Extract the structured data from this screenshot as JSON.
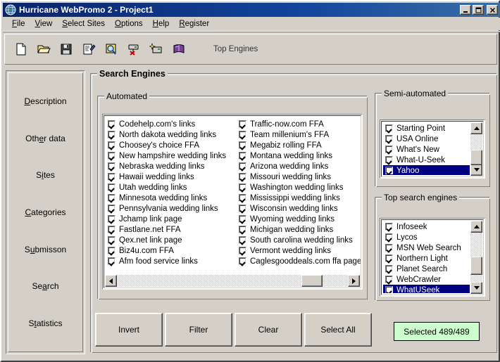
{
  "window": {
    "title": "Hurricane WebPromo 2 - Project1",
    "icon": "globe-icon",
    "controls": {
      "minimize": "_",
      "maximize": "□",
      "close": "✕"
    }
  },
  "menu": {
    "items": [
      {
        "label": "File",
        "accel": "F"
      },
      {
        "label": "View",
        "accel": "V"
      },
      {
        "label": "Select Sites",
        "accel": "S"
      },
      {
        "label": "Options",
        "accel": "O"
      },
      {
        "label": "Help",
        "accel": "H"
      },
      {
        "label": "Register",
        "accel": "R"
      }
    ]
  },
  "toolbar": {
    "buttons": [
      {
        "name": "new-document-icon"
      },
      {
        "name": "open-folder-icon"
      },
      {
        "name": "save-disk-icon"
      },
      {
        "name": "edit-form-icon"
      },
      {
        "name": "search-magnifier-icon"
      },
      {
        "name": "delete-server-icon"
      },
      {
        "name": "new-entry-wizard-icon"
      },
      {
        "name": "book-icon"
      }
    ],
    "label": "Top Engines"
  },
  "sidebar": {
    "items": [
      {
        "label": "Description",
        "accel": "D"
      },
      {
        "label": "Other data",
        "accel": "e"
      },
      {
        "label": "Sites",
        "accel": "i"
      },
      {
        "label": "Categories",
        "accel": "C"
      },
      {
        "label": "Submisson",
        "accel": "u"
      },
      {
        "label": "Search",
        "accel": "a"
      },
      {
        "label": "Statistics",
        "accel": "t"
      }
    ]
  },
  "main": {
    "group_title": "Search Engines",
    "automated": {
      "title": "Automated",
      "column_left": [
        {
          "label": "Codehelp.com's links",
          "checked": true
        },
        {
          "label": "North dakota wedding links",
          "checked": true
        },
        {
          "label": "Choosey's choice FFA",
          "checked": true
        },
        {
          "label": "New hampshire wedding links",
          "checked": true
        },
        {
          "label": "Nebraska wedding links",
          "checked": true
        },
        {
          "label": "Hawaii wedding links",
          "checked": true
        },
        {
          "label": "Utah wedding links",
          "checked": true
        },
        {
          "label": "Minnesota wedding links",
          "checked": true
        },
        {
          "label": "Pennsylvania wedding links",
          "checked": true
        },
        {
          "label": "Jchamp link page",
          "checked": true
        },
        {
          "label": "Fastlane.net FFA",
          "checked": true
        },
        {
          "label": "Qex.net link page",
          "checked": true
        },
        {
          "label": "Biz4u.com FFA",
          "checked": true
        },
        {
          "label": "Afm food service links",
          "checked": true
        }
      ],
      "column_right": [
        {
          "label": "Traffic-now.com FFA",
          "checked": true
        },
        {
          "label": "Team millenium's FFA",
          "checked": true
        },
        {
          "label": "Megabiz rolling FFA",
          "checked": true
        },
        {
          "label": "Montana wedding links",
          "checked": true
        },
        {
          "label": "Arizona wedding links",
          "checked": true
        },
        {
          "label": "Missouri wedding links",
          "checked": true
        },
        {
          "label": "Washington wedding links",
          "checked": true
        },
        {
          "label": "Mississippi wedding links",
          "checked": true
        },
        {
          "label": "Wisconsin wedding links",
          "checked": true
        },
        {
          "label": "Wyoming wedding links",
          "checked": true
        },
        {
          "label": "Michigan wedding links",
          "checked": true
        },
        {
          "label": "South carolina wedding links",
          "checked": true
        },
        {
          "label": "Vermont wedding links",
          "checked": true
        },
        {
          "label": "Caglesgooddeals.com ffa page",
          "checked": true
        }
      ]
    },
    "semi_automated": {
      "title": "Semi-automated",
      "items": [
        {
          "label": "Starting Point",
          "checked": true,
          "selected": false
        },
        {
          "label": "USA Online",
          "checked": true,
          "selected": false
        },
        {
          "label": "What's New",
          "checked": true,
          "selected": false
        },
        {
          "label": "What-U-Seek",
          "checked": true,
          "selected": false
        },
        {
          "label": "Yahoo",
          "checked": true,
          "selected": true
        }
      ]
    },
    "top_search_engines": {
      "title": "Top search engines",
      "items": [
        {
          "label": "Infoseek",
          "checked": true,
          "selected": false
        },
        {
          "label": "Lycos",
          "checked": true,
          "selected": false
        },
        {
          "label": "MSN Web Search",
          "checked": true,
          "selected": false
        },
        {
          "label": "Northern Light",
          "checked": true,
          "selected": false
        },
        {
          "label": "Planet Search",
          "checked": true,
          "selected": false
        },
        {
          "label": "WebCrawler",
          "checked": true,
          "selected": false
        },
        {
          "label": "WhatUSeek",
          "checked": true,
          "selected": true
        }
      ]
    },
    "buttons": {
      "invert": "Invert",
      "filter": "Filter",
      "clear": "Clear",
      "select_all": "Select All"
    },
    "status": {
      "text": "Selected 489/489",
      "background": "#ccffcc"
    }
  },
  "colors": {
    "face": "#d4d0c8",
    "title_bar": "#0a246a",
    "selection": "#000080",
    "status_green": "#ccffcc"
  }
}
